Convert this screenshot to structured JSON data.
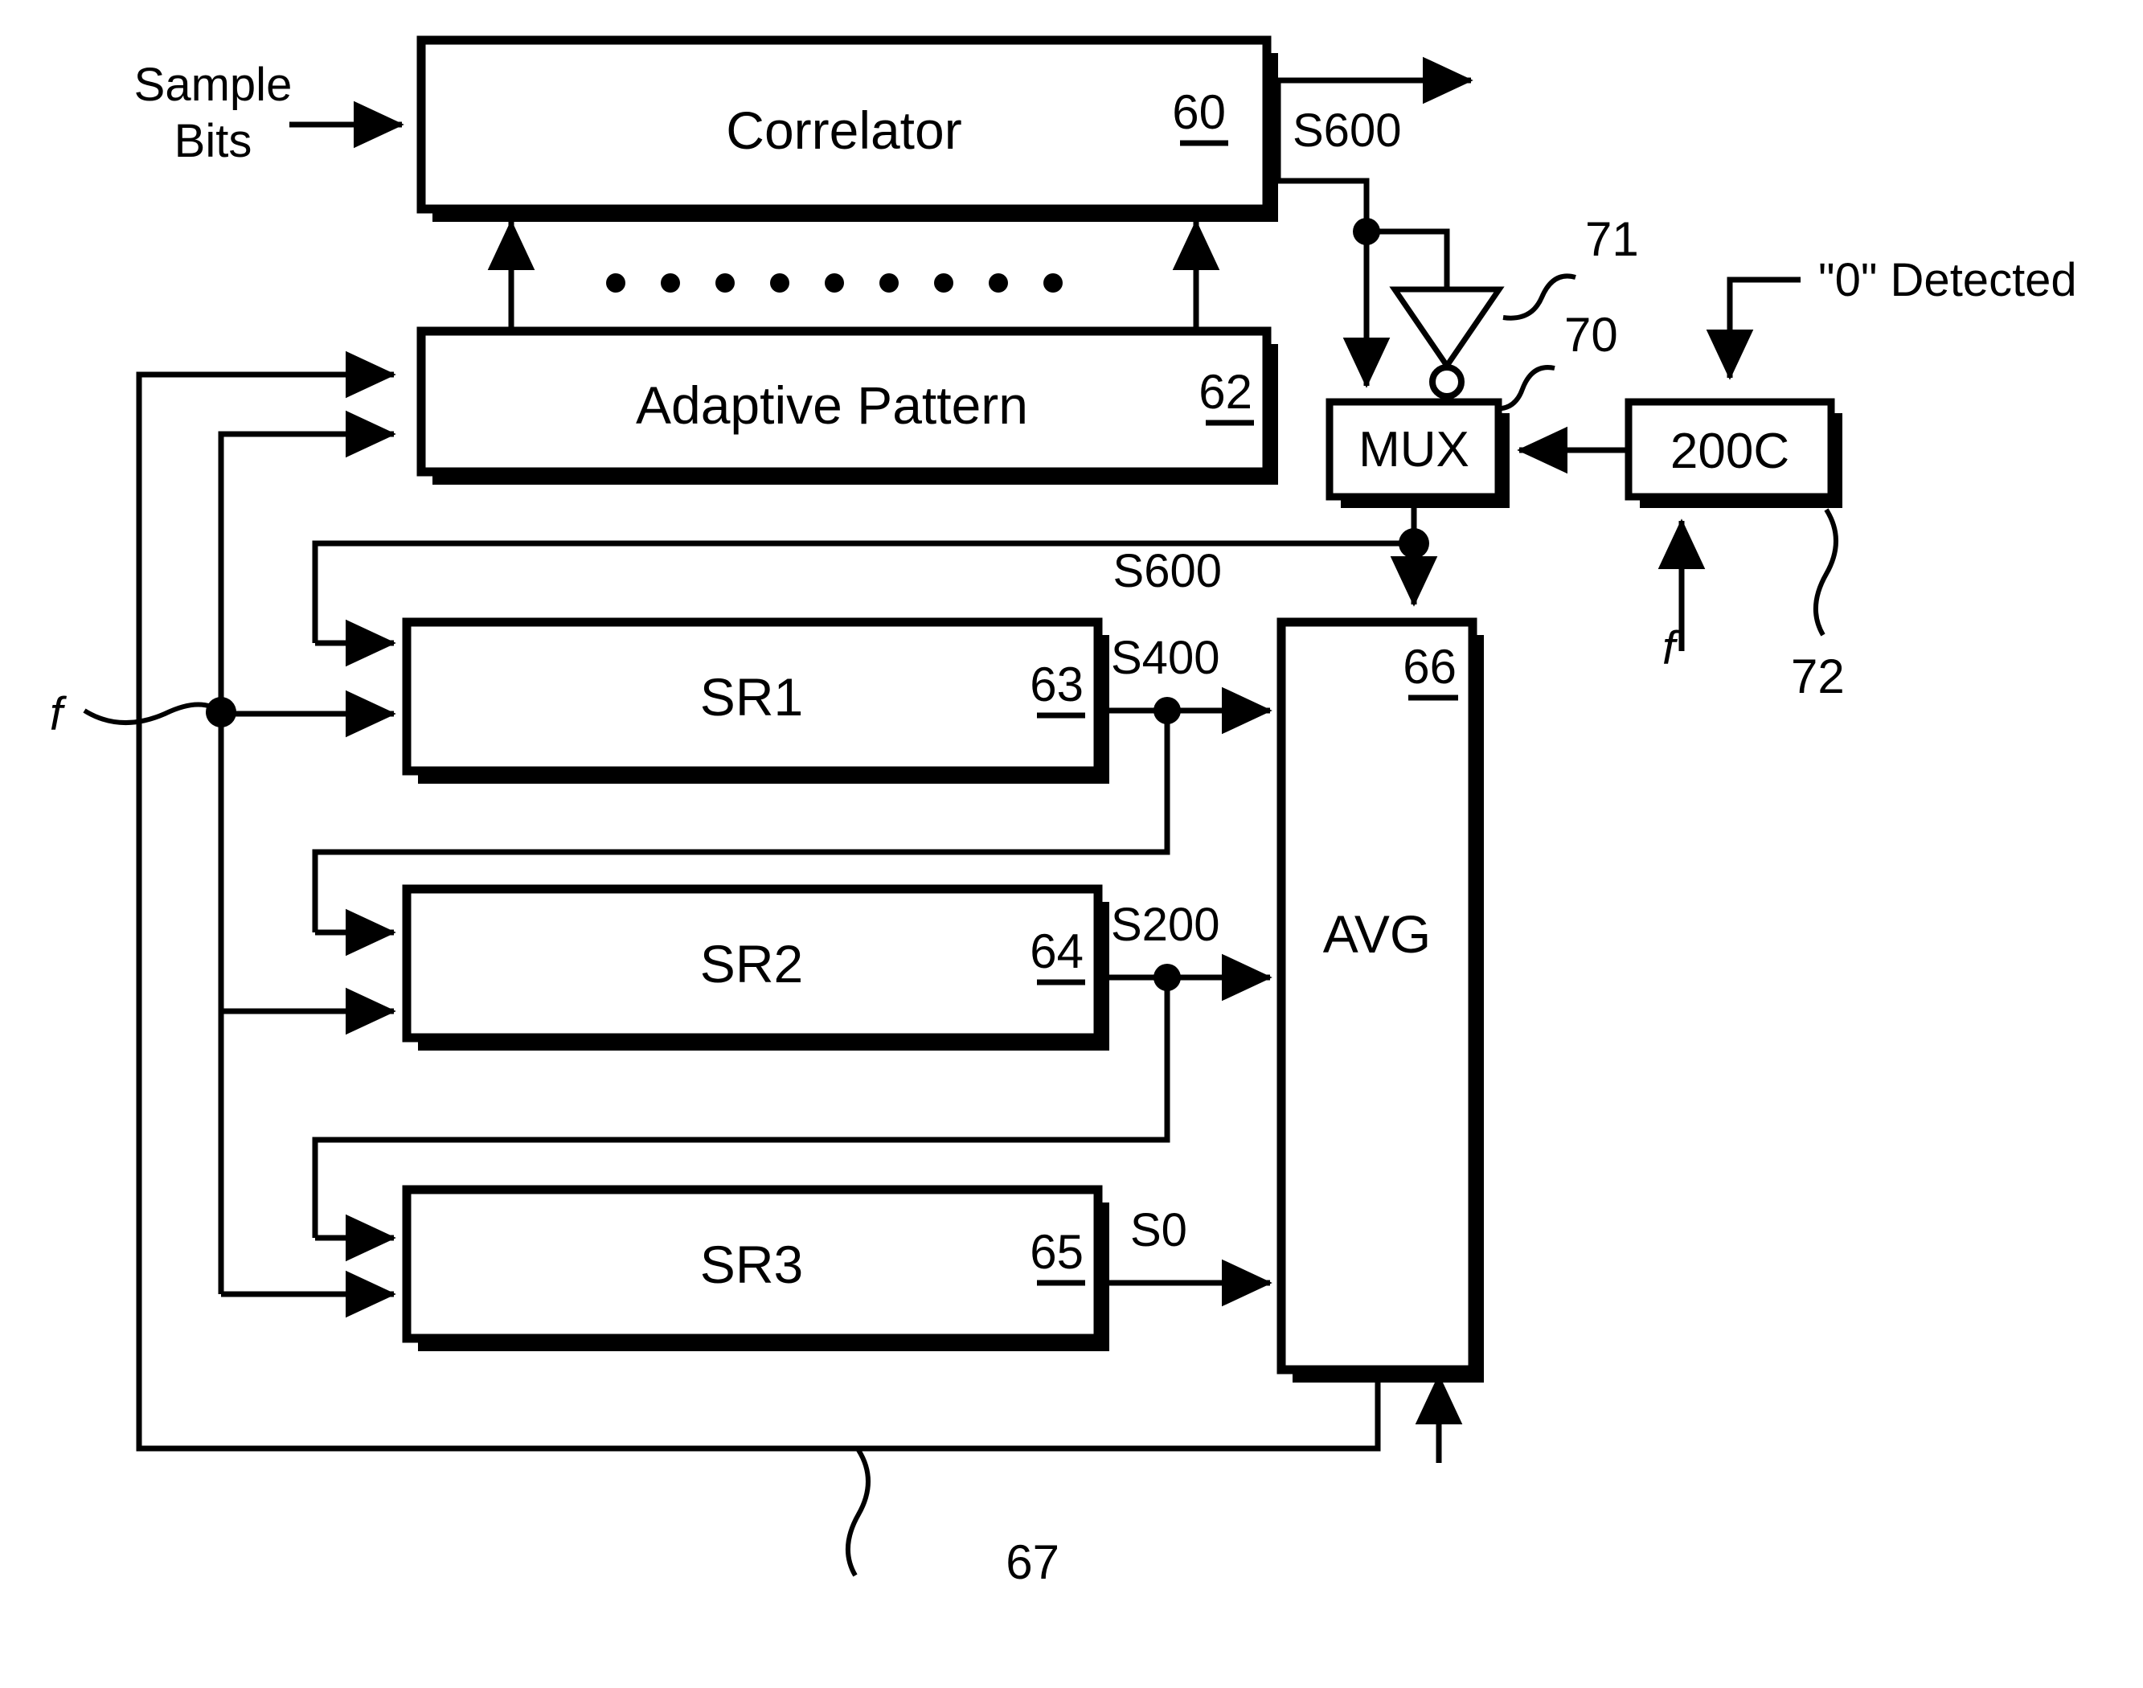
{
  "figure": {
    "type": "patent-block-diagram",
    "background": "#ffffff",
    "ink": "#000000"
  },
  "blocks": [
    {
      "id": "correlator",
      "label": "Correlator",
      "ref": "60"
    },
    {
      "id": "adaptive_pattern",
      "label": "Adaptive Pattern",
      "ref": "62"
    },
    {
      "id": "sr1",
      "label": "SR1",
      "ref": "63"
    },
    {
      "id": "sr2",
      "label": "SR2",
      "ref": "64"
    },
    {
      "id": "sr3",
      "label": "SR3",
      "ref": "65"
    },
    {
      "id": "avg",
      "label": "AVG",
      "ref": "66"
    },
    {
      "id": "mux",
      "label": "MUX",
      "ref": ""
    },
    {
      "id": "counter",
      "label": "200C",
      "ref": ""
    }
  ],
  "input_labels": {
    "sample_bits_line1": "Sample",
    "sample_bits_line2": "Bits",
    "zero_detected": "\"0\" Detected",
    "clock_left": "f",
    "clock_counter": "f"
  },
  "signal_labels": {
    "s600_top": "S600",
    "s600_feedback": "S600",
    "s400": "S400",
    "s200": "S200",
    "s0": "S0"
  },
  "reference_numerals": {
    "correlator": "60",
    "adaptive_pattern": "62",
    "sr1": "63",
    "sr2": "64",
    "sr3": "65",
    "avg": "66",
    "feedback_bus": "67",
    "mux": "70",
    "inverter": "71",
    "counter": "72"
  },
  "symbols": {
    "inverter": "inverter-triangle-with-bubble",
    "dots": "ellipsis-dots-row",
    "junction": "solid-junction-dot",
    "arrow": "solid-triangle-arrowhead"
  },
  "ellipsis_dot_count": 9
}
